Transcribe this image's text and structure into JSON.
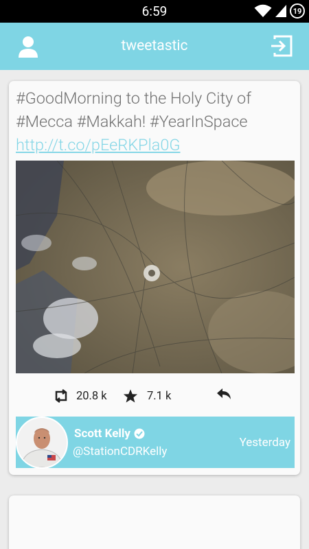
{
  "status_bar": {
    "time": "6:59",
    "battery_level": "19"
  },
  "app_bar": {
    "title": "tweetastic",
    "user_icon": "person-icon",
    "signout_icon": "sign-out-icon"
  },
  "tweet": {
    "text": "#GoodMorning to the Holy City of #Mecca #Makkah! #YearInSpace",
    "link": "http://t.co/pEeRKPla0G",
    "retweet_count": "20.8 k",
    "favorite_count": "7.1 k",
    "author": {
      "name": "Scott Kelly",
      "handle": "@StationCDRKelly",
      "verified": true
    },
    "timestamp": "Yesterday"
  },
  "colors": {
    "accent": "#7fd5e4",
    "link": "#84d6e6",
    "text": "#6f6f6f"
  }
}
